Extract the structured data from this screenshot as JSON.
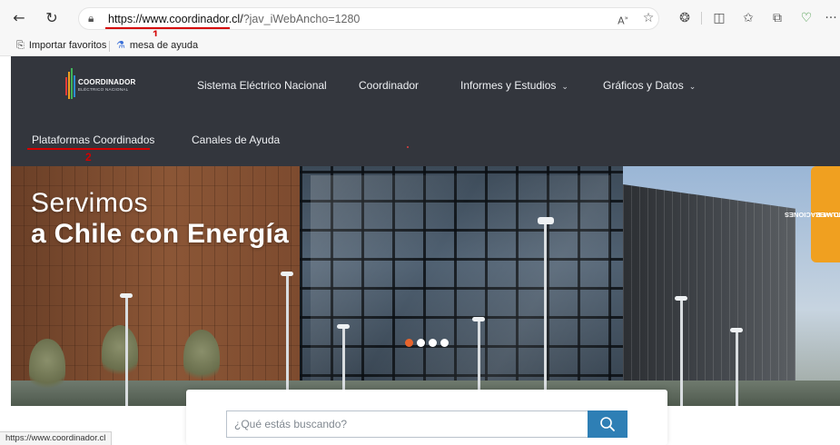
{
  "browser": {
    "url_host": "https://www.coordinador.cl/",
    "url_rest": "?jav_iWebAncho=1280",
    "favorites": [
      {
        "label": "Importar favoritos",
        "icon": "import-favorites-icon"
      },
      {
        "label": "mesa de ayuda",
        "icon": "flask-icon"
      }
    ],
    "status_url": "https://www.coordinador.cl"
  },
  "annotations": {
    "marker_1": "1",
    "marker_2": "2",
    "color": "#d40000"
  },
  "site": {
    "logo_title": "COORDINADOR",
    "logo_subtitle": "ELÉCTRICO NACIONAL",
    "nav": [
      {
        "label": "Sistema Eléctrico Nacional",
        "dropdown": false
      },
      {
        "label": "Coordinador",
        "dropdown": false
      },
      {
        "label": "Informes y Estudios",
        "dropdown": true
      },
      {
        "label": "Gráficos y Datos",
        "dropdown": true
      },
      {
        "label": "Plataformas Coordinados",
        "dropdown": false
      },
      {
        "label": "Canales de Ayuda",
        "dropdown": false
      }
    ],
    "colors": {
      "nav_bg": "#33363d",
      "accent_orange": "#f0a020",
      "carousel_active": "#e8642c",
      "search_button": "#2e7fb5"
    }
  },
  "hero": {
    "title_line1": "Servimos",
    "title_line2": "a Chile con Energía",
    "side_tab_line1": "ACTUALIZACIONES",
    "side_tab_line2": "SITIO WEB",
    "carousel": {
      "total": 4,
      "active": 1
    }
  },
  "search": {
    "placeholder": "¿Qué estás buscando?",
    "value": "",
    "icon": "search-icon"
  }
}
